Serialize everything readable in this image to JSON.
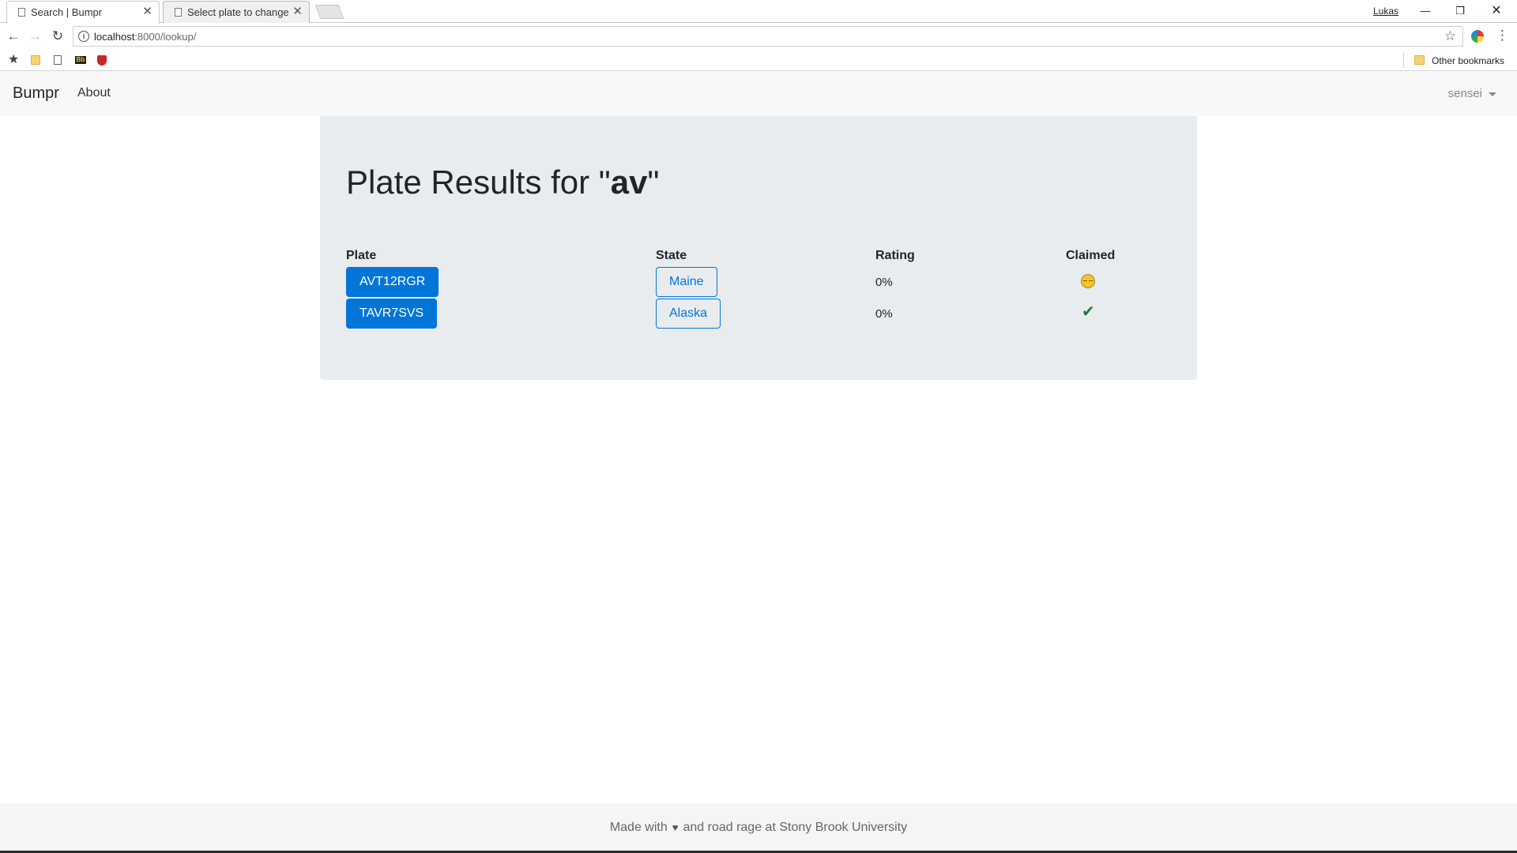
{
  "browser": {
    "tabs": [
      {
        "title": "Search | Bumpr",
        "close": "✕"
      },
      {
        "title": "Select plate to change | D",
        "close": "✕"
      }
    ],
    "window_user": "Lukas",
    "window_controls": {
      "minimize": "—",
      "maximize": "❐",
      "close": "✕"
    },
    "url_host": "localhost",
    "url_path": ":8000/lookup/",
    "bookmarks_other": "Other bookmarks"
  },
  "nav": {
    "brand": "Bumpr",
    "about": "About",
    "user": "sensei"
  },
  "page": {
    "title_prefix": "Plate Results for \"",
    "query": "av",
    "title_suffix": "\""
  },
  "table": {
    "headers": {
      "plate": "Plate",
      "state": "State",
      "rating": "Rating",
      "claimed": "Claimed"
    },
    "rows": [
      {
        "plate": "AVT12RGR",
        "state": "Maine",
        "rating": "0%",
        "claimed_icon": "unamused-face-icon"
      },
      {
        "plate": "TAVR7SVS",
        "state": "Alaska",
        "rating": "0%",
        "claimed_icon": "checkmark-icon"
      }
    ]
  },
  "footer": {
    "before": "Made with",
    "heart": "♥",
    "after": "and road rage at Stony Brook University"
  },
  "colors": {
    "primary": "#0275d8",
    "jumbotron": "#e9ecef",
    "navbar": "#f8f8f8",
    "check": "#1e7e34"
  }
}
